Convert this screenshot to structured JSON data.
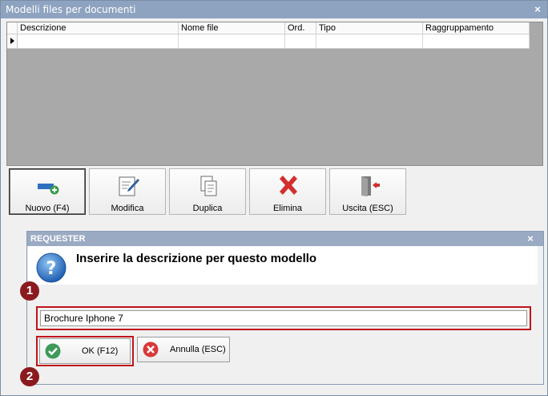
{
  "window": {
    "title": "Modelli files per documenti",
    "close_glyph": "×"
  },
  "grid": {
    "columns": [
      "Descrizione",
      "Nome file",
      "Ord.",
      "Tipo",
      "Raggruppamento"
    ],
    "row_indicator": "current-row"
  },
  "toolbar": {
    "buttons": [
      {
        "label": "Nuovo (F4)",
        "icon": "new-plus-icon",
        "active": true
      },
      {
        "label": "Modifica",
        "icon": "edit-pencil-icon"
      },
      {
        "label": "Duplica",
        "icon": "duplicate-icon"
      },
      {
        "label": "Elimina",
        "icon": "delete-x-icon"
      },
      {
        "label": "Uscita (ESC)",
        "icon": "exit-door-icon"
      }
    ]
  },
  "dialog": {
    "title": "REQUESTER",
    "close_glyph": "×",
    "message": "Inserire la descrizione per questo modello",
    "input_value": "Brochure Iphone 7",
    "ok_label": "OK (F12)",
    "cancel_label": "Annulla (ESC)"
  },
  "annotations": {
    "badge1": "1",
    "badge2": "2",
    "highlight_color": "#c0141a",
    "badge_color": "#8b1a1f"
  }
}
